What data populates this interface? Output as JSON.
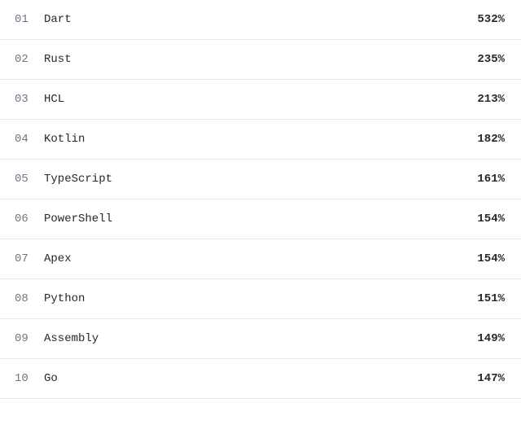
{
  "items": [
    {
      "rank": "01",
      "label": "Dart",
      "value": "532%"
    },
    {
      "rank": "02",
      "label": "Rust",
      "value": "235%"
    },
    {
      "rank": "03",
      "label": "HCL",
      "value": "213%"
    },
    {
      "rank": "04",
      "label": "Kotlin",
      "value": "182%"
    },
    {
      "rank": "05",
      "label": "TypeScript",
      "value": "161%"
    },
    {
      "rank": "06",
      "label": "PowerShell",
      "value": "154%"
    },
    {
      "rank": "07",
      "label": "Apex",
      "value": "154%"
    },
    {
      "rank": "08",
      "label": "Python",
      "value": "151%"
    },
    {
      "rank": "09",
      "label": "Assembly",
      "value": "149%"
    },
    {
      "rank": "10",
      "label": "Go",
      "value": "147%"
    }
  ]
}
